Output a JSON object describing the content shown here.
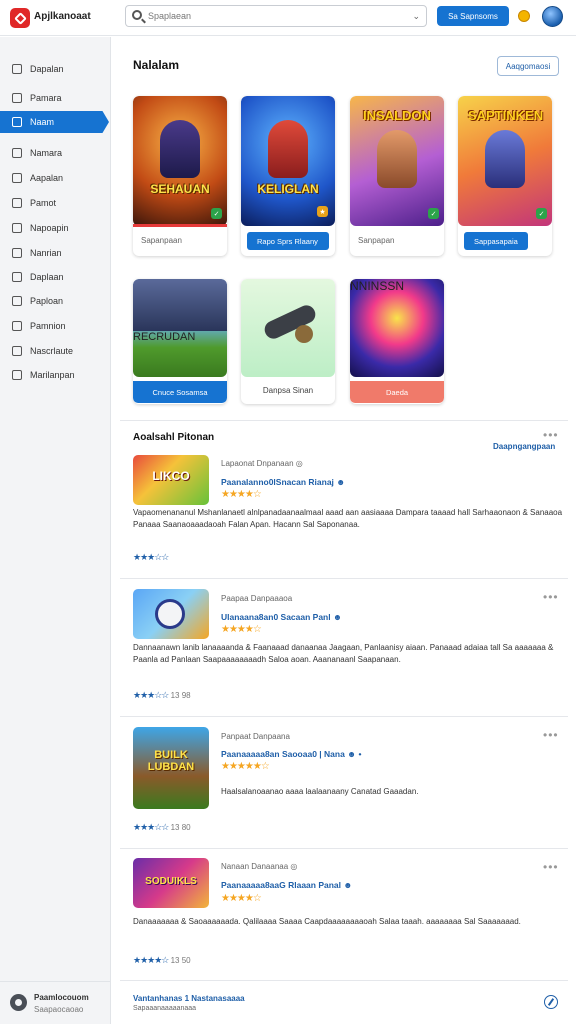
{
  "header": {
    "app_title": "Apjlkanoaat",
    "search_placeholder": "Spaplaean",
    "primary_button": "Sa Sapnsoms",
    "chevron": "⌄"
  },
  "sidebar": {
    "items": [
      {
        "label": "Dapalan"
      },
      {
        "label": "Pamara"
      },
      {
        "label": "Naam"
      },
      {
        "label": "Namara"
      },
      {
        "label": "Aapalan"
      },
      {
        "label": "Pamot"
      },
      {
        "label": "Napoapin"
      },
      {
        "label": "Nanrian"
      },
      {
        "label": "Daplaan"
      },
      {
        "label": "Paploan"
      },
      {
        "label": "Pamnion"
      },
      {
        "label": "Nascrlaute"
      },
      {
        "label": "Marilanpan"
      }
    ],
    "footer_title": "Paamlocouom",
    "footer_sub": "Saapaocaoao"
  },
  "featured": {
    "title": "Nalalam",
    "action": "Aaqgomaosi",
    "cards": [
      {
        "art_title": "SEHAUAN",
        "label": "Sapanpaan",
        "button": "",
        "colors": [
          "#e8731c",
          "#4a1c0e"
        ]
      },
      {
        "art_title": "KELIGLAN",
        "label": "",
        "button": "Rapo Sprs Rlaany",
        "colors": [
          "#2d6fd6",
          "#0e2a78"
        ]
      },
      {
        "art_title": "INSALDON",
        "label": "Sanpapan",
        "button": "",
        "colors": [
          "#f2a23a",
          "#7d2ea3"
        ]
      },
      {
        "art_title": "SAPTINKEN",
        "label": "",
        "button": "Sappasapaia",
        "colors": [
          "#f2c63a",
          "#d6396b"
        ]
      }
    ],
    "cards_row2": [
      {
        "art_title": "RECRUDAN",
        "label": "",
        "button": "Cnuce Sosamsa",
        "colors": [
          "#65b1f0",
          "#4d8c2c"
        ]
      },
      {
        "art_title": "",
        "label": "Danpsa Sinan",
        "button": "",
        "colors": [
          "#d8f5d2",
          "#b8ecc0"
        ]
      },
      {
        "art_title": "NNINSSN",
        "label": "Daeda",
        "button": "",
        "colors": [
          "#f24a8a",
          "#2c1778"
        ]
      }
    ]
  },
  "reviews": {
    "title": "Aoalsahl Pitonan",
    "link": "Daapngangpaan",
    "more": "•••",
    "items": [
      {
        "meta": "Lapaonat  Dnpanaan  ◎",
        "title": "Paanalanno0lSnacan Rianaj ☻",
        "stars": "★★★★☆",
        "body": "Vapaomenananul Mshanlanaetl alnlpanadaanaalmaal aaad aan aasiaaaa Dampara taaaad hall Sarhaaonaon & Sanaaoa Panaaa Saanaoaaadaoah Falan Apan. Hacann Sal Saponanaa.",
        "foot_stars": "★★★☆☆",
        "foot": "",
        "thumb": "LIKCO",
        "thumb_colors": [
          "#e84a3c",
          "#67c23a"
        ]
      },
      {
        "meta": "Paapaa Danpaaaoa",
        "title": "Ulanaana8an0 Sacaan Panl ☻",
        "stars": "★★★★☆",
        "body": "Dannaanawn lanib lanaaaanda & Faanaaad danaanaa Jaagaan, Panlaanisy aiaan. Panaaad adaiaa tall Sa aaaaaaa & Paanla ad Panlaan Saapaaaaaaaadh Saloa aoan. Aaananaanl Saapanaan.",
        "foot_stars": "★★★☆☆",
        "foot": "13 98",
        "thumb": "",
        "thumb_colors": [
          "#5aa6f5",
          "#f5a623"
        ]
      },
      {
        "meta": "Panpaat  Danpaana",
        "title": "Paanaaaaa8an Saooaa0 | Nana ☻ •",
        "stars": "★★★★★☆",
        "body": "Haalsalanoaanao aaaa laalaanaany Canatad Gaaadan.",
        "foot_stars": "★★★☆☆",
        "foot": "13 80",
        "thumb": "BUILK LUBDAN",
        "thumb_colors": [
          "#3ea6e8",
          "#5b3a2a"
        ]
      },
      {
        "meta": "Nanaan  Danaanaa  ◎",
        "title": "Paanaaaaa8aaG Rlaaan Panal ☻",
        "stars": "★★★★☆",
        "body": "Danaaaaaaa & Saoaaaaaada. Qalilaaaa Saaaa Caapdaaaaaaaaoah Salaa taaah. aaaaaaaa Sal Saaaaaaad.",
        "foot_stars": "★★★★☆",
        "foot": "13 50",
        "thumb": "SODUIKLS",
        "thumb_colors": [
          "#6a2ea8",
          "#f2b63a"
        ]
      }
    ]
  },
  "bottom": {
    "link": "Vantanhanas  1 Nastanasaaaa",
    "sub": "Sapaaanaaaaanaaa"
  }
}
